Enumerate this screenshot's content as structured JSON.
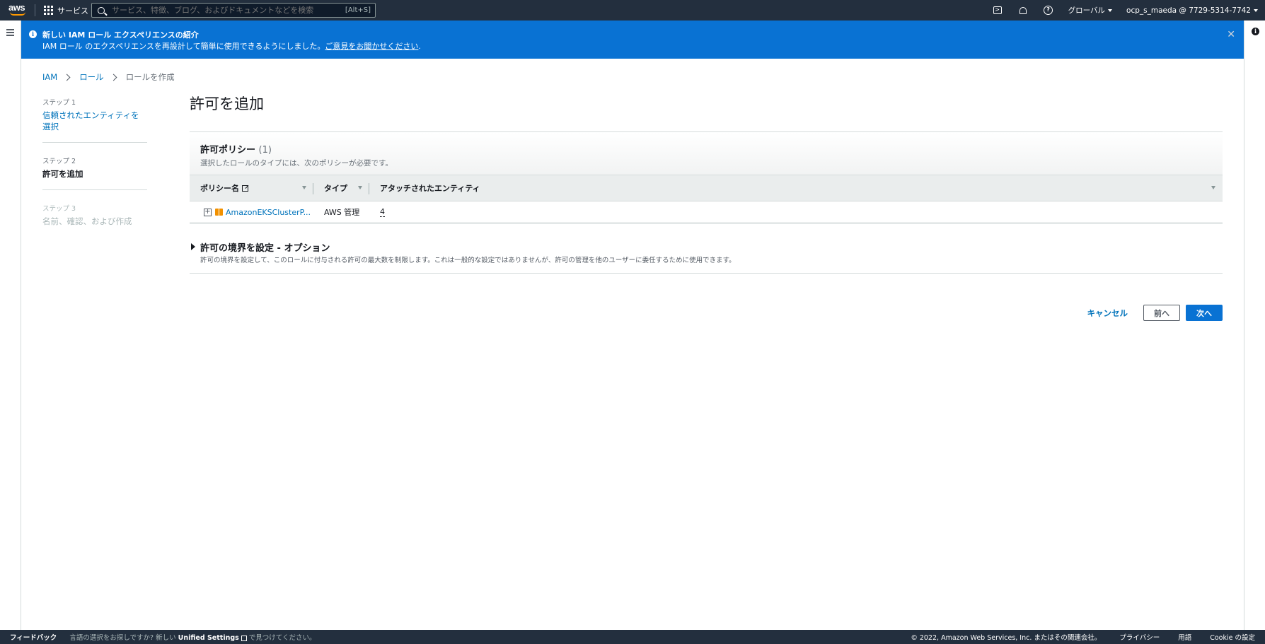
{
  "topnav": {
    "logo_text": "aws",
    "services_label": "サービス",
    "search_placeholder": "サービス、特徴、ブログ、およびドキュメントなどを検索",
    "search_shortcut": "[Alt+S]",
    "region_label": "グローバル",
    "account_label": "ocp_s_maeda @ 7729-5314-7742"
  },
  "flash": {
    "title": "新しい IAM ロール エクスペリエンスの紹介",
    "body": "IAM ロール のエクスペリエンスを再設計して簡単に使用できるようにしました。",
    "link": "ご意見をお聞かせください",
    "link_suffix": "."
  },
  "breadcrumb": {
    "items": [
      "IAM",
      "ロール"
    ],
    "current": "ロールを作成"
  },
  "steps": [
    {
      "label": "ステップ 1",
      "name": "信頼されたエンティティを選択"
    },
    {
      "label": "ステップ 2",
      "name": "許可を追加"
    },
    {
      "label": "ステップ 3",
      "name": "名前、確認、および作成"
    }
  ],
  "page_title": "許可を追加",
  "policies": {
    "title": "許可ポリシー",
    "count": "(1)",
    "subtitle": "選択したロールのタイプには、次のポリシーが必要です。",
    "columns": [
      "ポリシー名",
      "タイプ",
      "アタッチされたエンティティ"
    ],
    "rows": [
      {
        "name": "AmazonEKSClusterP...",
        "type": "AWS 管理",
        "entities": "4"
      }
    ]
  },
  "boundary": {
    "title": "許可の境界を設定 - オプション",
    "description": "許可の境界を設定して、このロールに付与される許可の最大数を制限します。これは一般的な設定ではありませんが、許可の管理を他のユーザーに委任するために使用できます。"
  },
  "actions": {
    "cancel": "キャンセル",
    "previous": "前へ",
    "next": "次へ"
  },
  "footer": {
    "feedback": "フィードバック",
    "message_pre": "言語の選択をお探しですか? 新しい",
    "message_bold": "Unified Settings",
    "message_post": "で見つけてください。",
    "copyright": "© 2022, Amazon Web Services, Inc. またはその関連会社。",
    "privacy": "プライバシー",
    "terms": "用語",
    "cookie": "Cookie の設定"
  },
  "colors": {
    "nav_bg": "#232f3e",
    "flash_bg": "#0972d3",
    "link": "#0073bb",
    "primary_button": "#0972d3",
    "policy_icon": "#f29100"
  }
}
